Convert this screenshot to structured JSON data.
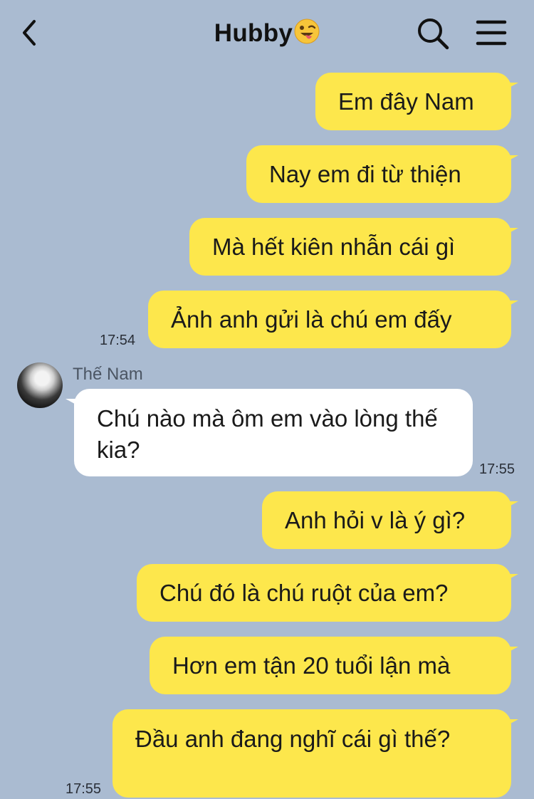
{
  "header": {
    "title": "Hubby",
    "title_emoji": "😜",
    "back_icon": "chevron-left-icon",
    "search_icon": "search-icon",
    "menu_icon": "hamburger-menu-icon"
  },
  "colors": {
    "background": "#aabbd1",
    "my_bubble": "#fde74c",
    "their_bubble": "#ffffff"
  },
  "messages": [
    {
      "from": "me",
      "text": "Em đây Nam"
    },
    {
      "from": "me",
      "text": "Nay em đi từ thiện"
    },
    {
      "from": "me",
      "text": "Mà hết kiên nhẫn cái gì"
    },
    {
      "from": "me",
      "text": "Ảnh anh gửi là chú em đấy",
      "time": "17:54"
    },
    {
      "from": "them",
      "sender": "Thế Nam",
      "text": "Chú nào mà ôm em vào lòng thế kia?",
      "time": "17:55"
    },
    {
      "from": "me",
      "text": "Anh hỏi v là ý gì?"
    },
    {
      "from": "me",
      "text": "Chú đó là chú ruột của em?"
    },
    {
      "from": "me",
      "text": "Hơn em tận 20 tuổi lận mà"
    },
    {
      "from": "me",
      "text": "Đầu anh đang nghĩ cái gì thế?",
      "time": "17:55"
    }
  ]
}
